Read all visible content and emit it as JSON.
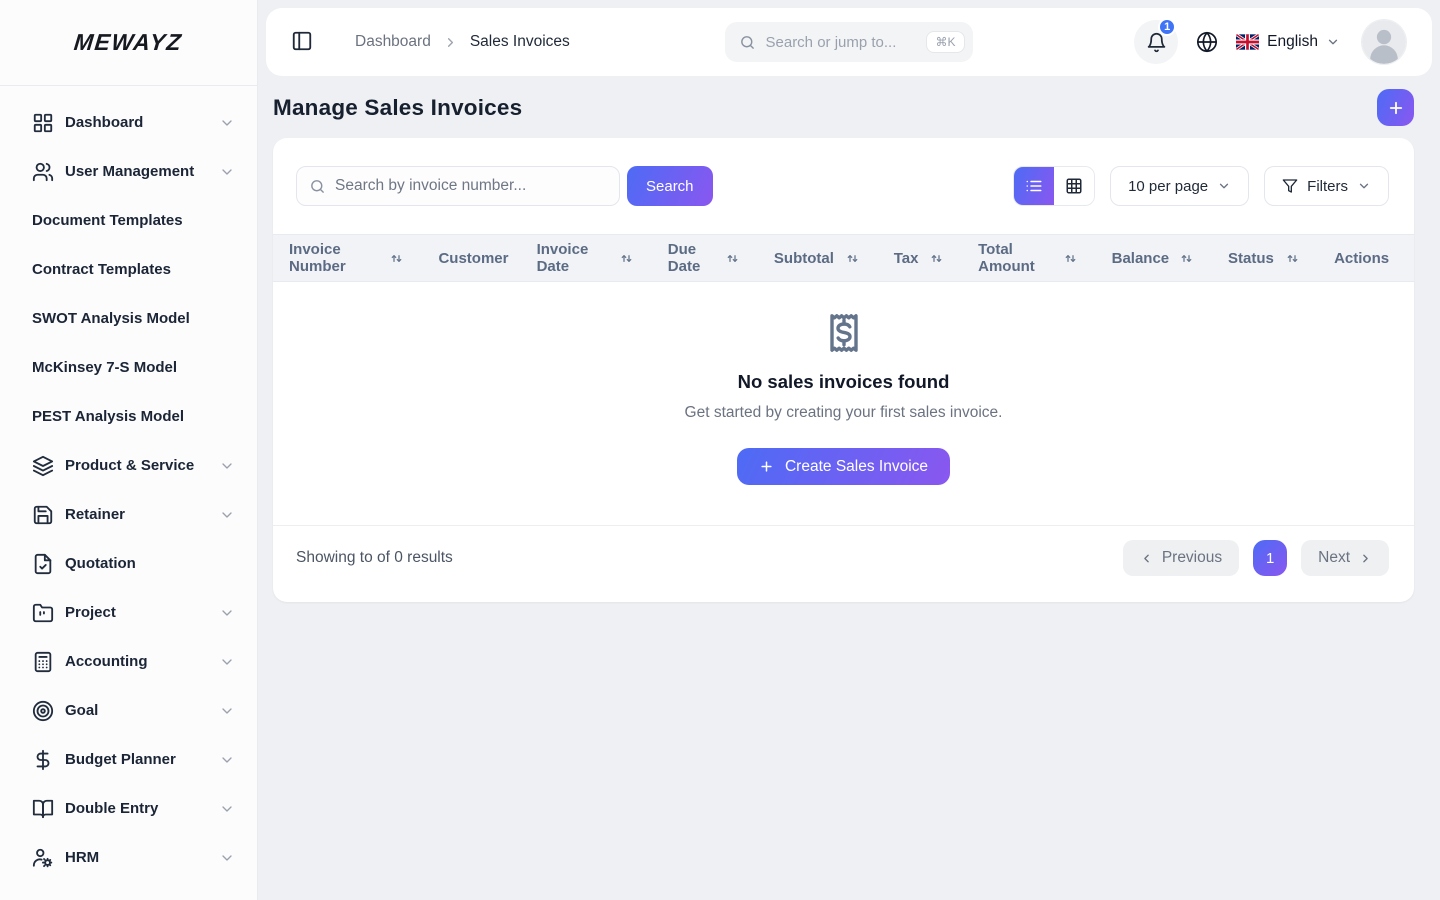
{
  "app": {
    "logo": "MEWAYZ"
  },
  "colors": {
    "accent_from": "#4d6bf5",
    "accent_to": "#8a57f0",
    "badge_blue": "#3f74f6"
  },
  "sidebar": {
    "items": [
      {
        "label": "Dashboard",
        "icon": "grid-icon",
        "chevron": true
      },
      {
        "label": "User Management",
        "icon": "users-icon",
        "chevron": true
      },
      {
        "label": "Document Templates",
        "icon": null,
        "chevron": false
      },
      {
        "label": "Contract Templates",
        "icon": null,
        "chevron": false
      },
      {
        "label": "SWOT Analysis Model",
        "icon": null,
        "chevron": false
      },
      {
        "label": "McKinsey 7-S Model",
        "icon": null,
        "chevron": false
      },
      {
        "label": "PEST Analysis Model",
        "icon": null,
        "chevron": false
      },
      {
        "label": "Product & Service",
        "icon": "layers-icon",
        "chevron": true
      },
      {
        "label": "Retainer",
        "icon": "save-icon",
        "chevron": true
      },
      {
        "label": "Quotation",
        "icon": "file-check-icon",
        "chevron": false
      },
      {
        "label": "Project",
        "icon": "folder-icon",
        "chevron": true
      },
      {
        "label": "Accounting",
        "icon": "calculator-icon",
        "chevron": true
      },
      {
        "label": "Goal",
        "icon": "target-icon",
        "chevron": true
      },
      {
        "label": "Budget Planner",
        "icon": "dollar-icon",
        "chevron": true
      },
      {
        "label": "Double Entry",
        "icon": "book-open-icon",
        "chevron": true
      },
      {
        "label": "HRM",
        "icon": "user-gear-icon",
        "chevron": true
      }
    ]
  },
  "topbar": {
    "breadcrumb": {
      "parent": "Dashboard",
      "current": "Sales Invoices"
    },
    "search": {
      "placeholder": "Search or jump to...",
      "shortcut": "⌘K"
    },
    "notifications": {
      "count": "1"
    },
    "language": {
      "label": "English"
    }
  },
  "page": {
    "title": "Manage Sales Invoices"
  },
  "toolbar": {
    "search_placeholder": "Search by invoice number...",
    "search_button": "Search",
    "per_page": "10 per page",
    "filters_label": "Filters"
  },
  "table": {
    "columns": [
      {
        "label": "Invoice Number",
        "sortable": true
      },
      {
        "label": "Customer",
        "sortable": false
      },
      {
        "label": "Invoice Date",
        "sortable": true
      },
      {
        "label": "Due Date",
        "sortable": true
      },
      {
        "label": "Subtotal",
        "sortable": true
      },
      {
        "label": "Tax",
        "sortable": true
      },
      {
        "label": "Total Amount",
        "sortable": true
      },
      {
        "label": "Balance",
        "sortable": true
      },
      {
        "label": "Status",
        "sortable": true
      },
      {
        "label": "Actions",
        "sortable": false
      }
    ]
  },
  "empty_state": {
    "title": "No sales invoices found",
    "subtitle": "Get started by creating your first sales invoice.",
    "cta_label": "Create Sales Invoice",
    "icon": "receipt-dollar-icon"
  },
  "pagination": {
    "summary": "Showing to of 0 results",
    "previous_label": "Previous",
    "current_page": "1",
    "next_label": "Next"
  }
}
